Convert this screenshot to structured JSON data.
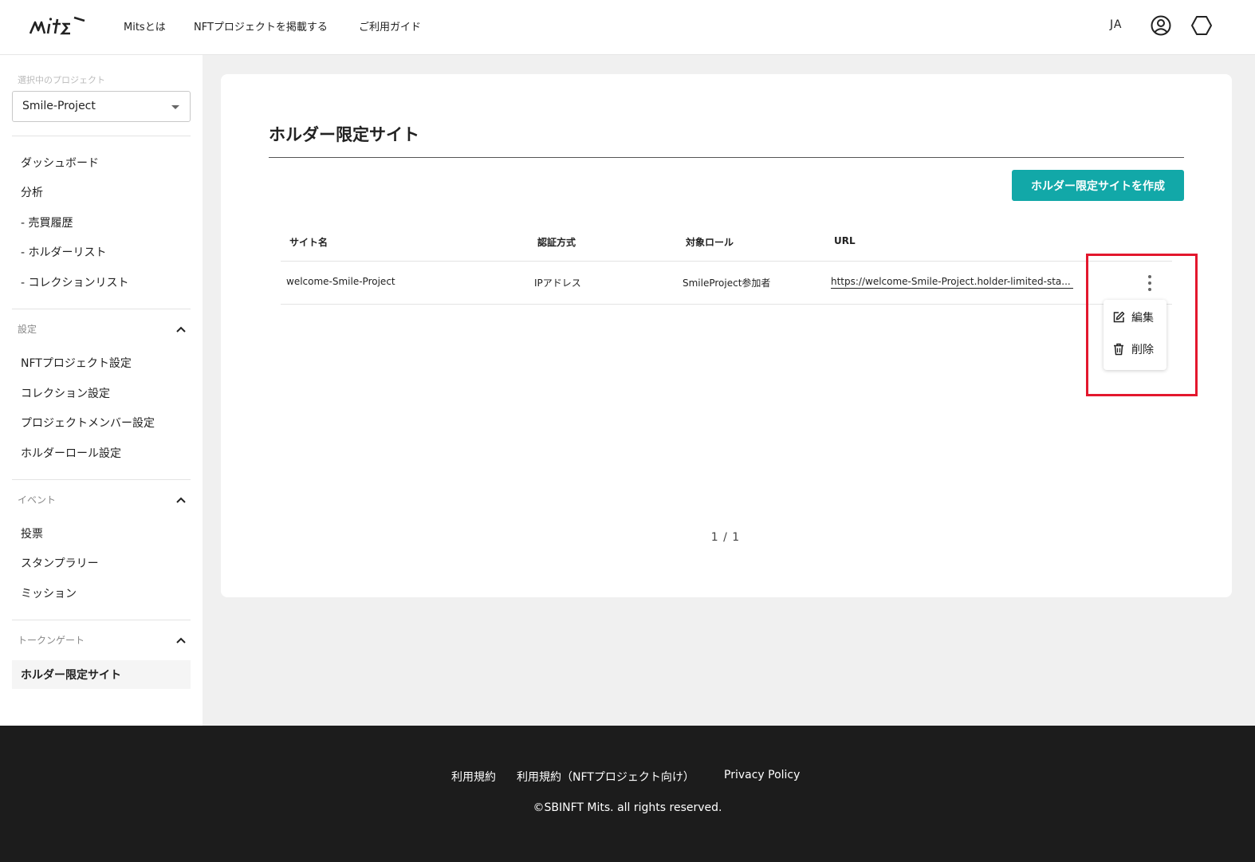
{
  "header": {
    "logo_text": "mits",
    "nav": [
      "Mitsとは",
      "NFTプロジェクトを掲載する",
      "ご利用ガイド"
    ],
    "lang": "JA",
    "icons": [
      "account-icon",
      "wallet-hexagon-icon"
    ]
  },
  "sidebar": {
    "project_caption": "選択中のプロジェクト",
    "project_value": "Smile-Project",
    "main_items": [
      "ダッシュボード",
      "分析",
      "- 売買履歴",
      "- ホルダーリスト",
      "- コレクションリスト"
    ],
    "settings": {
      "label": "設定",
      "items": [
        "NFTプロジェクト設定",
        "コレクション設定",
        "プロジェクトメンバー設定",
        "ホルダーロール設定"
      ]
    },
    "events": {
      "label": "イベント",
      "items": [
        "投票",
        "スタンプラリー",
        "ミッション"
      ]
    },
    "token_gate": {
      "label": "トークンゲート",
      "items": [
        "ホルダー限定サイト"
      ]
    }
  },
  "main": {
    "title": "ホルダー限定サイト",
    "create_button": "ホルダー限定サイトを作成",
    "table": {
      "headers": [
        "サイト名",
        "認証方式",
        "対象ロール",
        "URL"
      ],
      "rows": [
        [
          "welcome-Smile-Project",
          "IPアドレス",
          "SmileProject参加者",
          "https://welcome-Smile-Project.holder-limited-sta..."
        ]
      ]
    },
    "row_menu": {
      "items": [
        {
          "label": "編集",
          "icon": "edit-icon"
        },
        {
          "label": "削除",
          "icon": "trash-icon"
        }
      ]
    },
    "pagination": "1 / 1"
  },
  "footer": {
    "links": [
      "利用規約",
      "利用規約（NFTプロジェクト向け）",
      "Privacy Policy"
    ],
    "copyright": "©SBINFT Mits. all rights reserved."
  },
  "colors": {
    "accent": "#12a8a8",
    "highlight": "#e3172d",
    "footer_bg": "#1c1c1c"
  }
}
